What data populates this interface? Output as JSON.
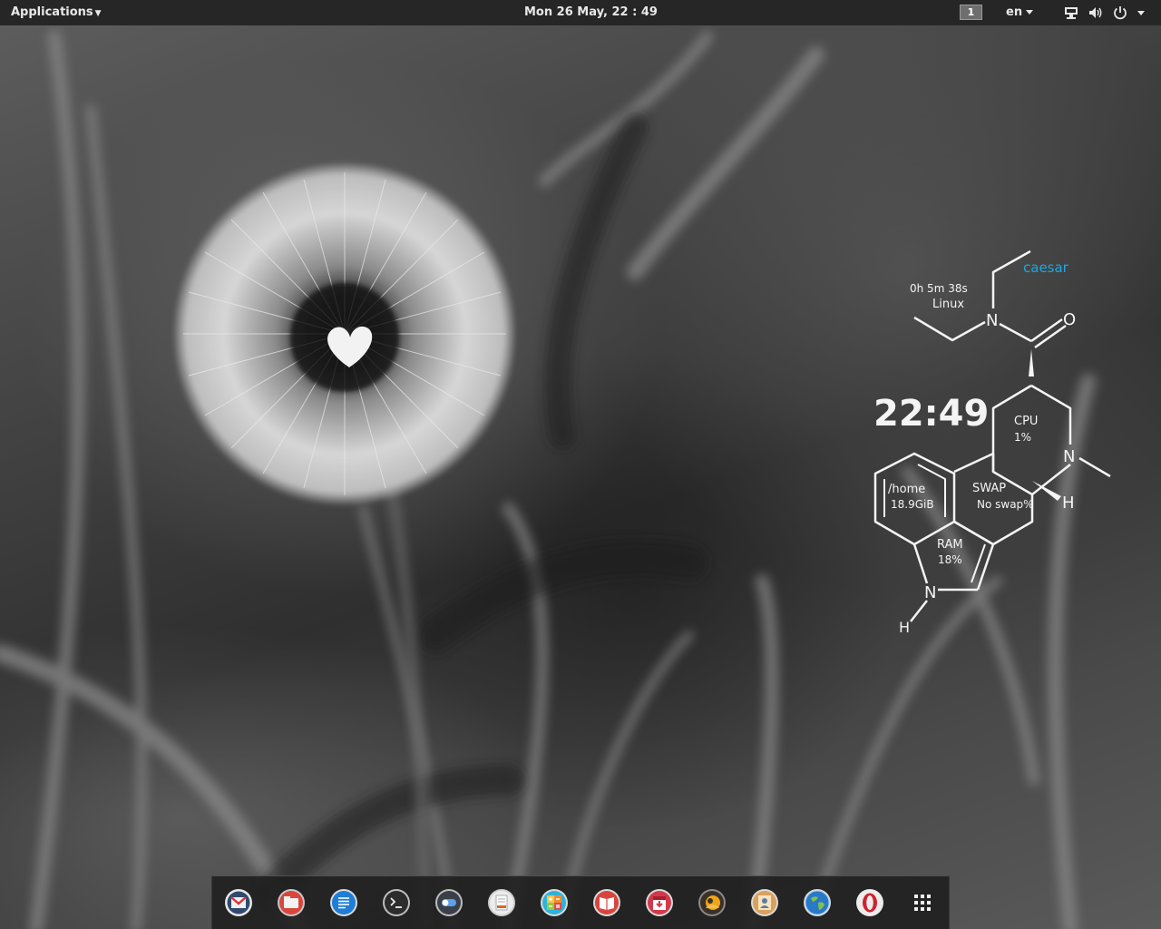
{
  "top_panel": {
    "applications_label": "Applications",
    "clock": "Mon 26 May, 22 : 49",
    "workspace": "1",
    "language": "en",
    "tray_icons": [
      "network-icon",
      "volume-icon",
      "power-icon"
    ]
  },
  "conky": {
    "username": "caesar",
    "uptime": "0h 5m 38s",
    "os": "Linux",
    "time": "22:49",
    "cpu_label": "CPU",
    "cpu_value": "1%",
    "swap_label": "SWAP",
    "swap_value": "No swap%",
    "home_label": "/home",
    "home_value": "18.9GiB",
    "ram_label": "RAM",
    "ram_value": "18%",
    "atom_n": "N",
    "atom_o": "O",
    "atom_h": "H",
    "accent_color": "#1ea7e1"
  },
  "dock": {
    "items": [
      "mail-icon",
      "files-icon",
      "text-editor-icon",
      "terminal-icon",
      "settings-switch-icon",
      "document-viewer-icon",
      "calculator-icon",
      "ebook-reader-icon",
      "calendar-icon",
      "photo-editor-icon",
      "contacts-icon",
      "web-browser-icon",
      "opera-icon",
      "app-grid-icon"
    ]
  }
}
